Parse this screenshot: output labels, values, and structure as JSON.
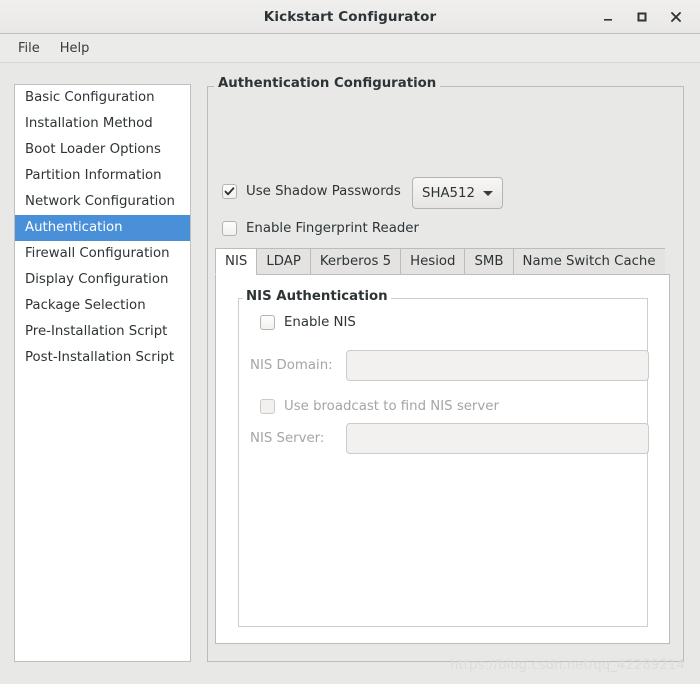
{
  "window": {
    "title": "Kickstart Configurator",
    "controls": [
      {
        "name": "minimize",
        "glyph": "minimize-icon"
      },
      {
        "name": "maximize",
        "glyph": "maximize-icon"
      },
      {
        "name": "close",
        "glyph": "close-icon"
      }
    ]
  },
  "menubar": {
    "items": [
      {
        "label": "File"
      },
      {
        "label": "Help"
      }
    ]
  },
  "sidebar": {
    "items": [
      {
        "label": "Basic Configuration",
        "selected": false
      },
      {
        "label": "Installation Method",
        "selected": false
      },
      {
        "label": "Boot Loader Options",
        "selected": false
      },
      {
        "label": "Partition Information",
        "selected": false
      },
      {
        "label": "Network Configuration",
        "selected": false
      },
      {
        "label": "Authentication",
        "selected": true
      },
      {
        "label": "Firewall Configuration",
        "selected": false
      },
      {
        "label": "Display Configuration",
        "selected": false
      },
      {
        "label": "Package Selection",
        "selected": false
      },
      {
        "label": "Pre-Installation Script",
        "selected": false
      },
      {
        "label": "Post-Installation Script",
        "selected": false
      }
    ],
    "selection_color": "#4a90d9"
  },
  "main": {
    "group_title": "Authentication Configuration",
    "shadow_passwords": {
      "label": "Use Shadow Passwords",
      "checked": true
    },
    "hash_combo": {
      "value": "SHA512",
      "arrow": "chevron-down-icon"
    },
    "fingerprint": {
      "label": "Enable Fingerprint Reader",
      "checked": false
    },
    "tabs": [
      {
        "label": "NIS",
        "active": true
      },
      {
        "label": "LDAP",
        "active": false
      },
      {
        "label": "Kerberos 5",
        "active": false
      },
      {
        "label": "Hesiod",
        "active": false
      },
      {
        "label": "SMB",
        "active": false
      },
      {
        "label": "Name Switch Cache",
        "active": false
      }
    ],
    "nis": {
      "group_title": "NIS Authentication",
      "enable": {
        "label": "Enable NIS",
        "checked": false
      },
      "domain": {
        "label": "NIS Domain:",
        "value": "",
        "placeholder": "",
        "disabled": true
      },
      "broadcast": {
        "label": "Use broadcast to find NIS server",
        "checked": false,
        "disabled": true
      },
      "server": {
        "label": "NIS Server:",
        "value": "",
        "placeholder": "",
        "disabled": true
      }
    }
  },
  "watermark": {
    "text": "https://blog.csdn.net/qq_42289214"
  }
}
